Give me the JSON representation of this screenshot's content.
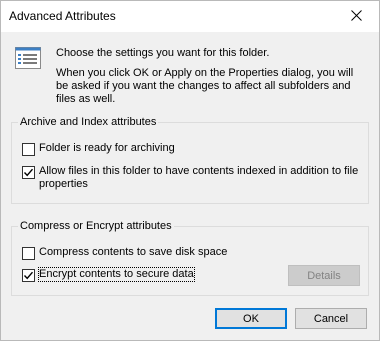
{
  "window": {
    "title": "Advanced Attributes",
    "close_glyph": "✕"
  },
  "info": {
    "icon": "attributes-list-icon",
    "main_text": "Choose the settings you want for this folder.",
    "sub_text": "When you click OK or Apply on the Properties dialog, you will be asked if you want the changes to affect all subfolders and files as well."
  },
  "archive_group": {
    "legend": "Archive and Index attributes",
    "items": [
      {
        "label": "Folder is ready for archiving",
        "checked": false
      },
      {
        "label": "Allow files in this folder to have contents indexed in addition to file properties",
        "checked": true
      }
    ]
  },
  "compress_group": {
    "legend": "Compress or Encrypt attributes",
    "items": [
      {
        "label": "Compress contents to save disk space",
        "checked": false
      },
      {
        "label": "Encrypt contents to secure data",
        "checked": true
      }
    ],
    "details_label": "Details",
    "details_enabled": false
  },
  "footer": {
    "ok_label": "OK",
    "cancel_label": "Cancel"
  },
  "colors": {
    "accent": "#0078d7",
    "dialog_bg": "#f0f0f0",
    "titlebar_bg": "#ffffff"
  }
}
